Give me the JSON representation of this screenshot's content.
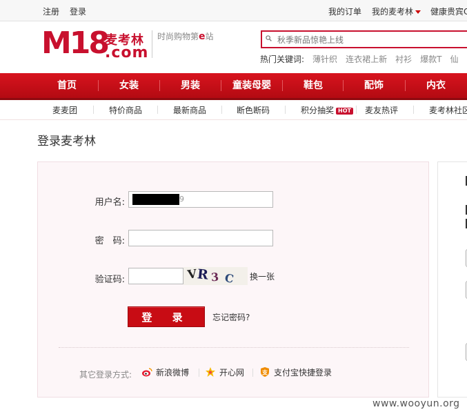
{
  "topbar": {
    "register": "注册",
    "login": "登录",
    "my_orders": "我的订单",
    "my_account": "我的麦考林",
    "partial_link": "健康贵宾C"
  },
  "header": {
    "logo_mark": "M18",
    "logo_cn": "麦考林",
    "logo_com": ".com",
    "slogan_pre": "时尚购物第",
    "slogan_e": "e",
    "slogan_post": "站",
    "search_placeholder": "秋季新品惊艳上线",
    "hot_label": "热门关键词:",
    "hot_words": [
      "薄针织",
      "连衣裙上新",
      "衬衫",
      "爆款T",
      "仙"
    ]
  },
  "main_nav": [
    "首页",
    "女装",
    "男装",
    "童装母婴",
    "鞋包",
    "配饰",
    "内衣"
  ],
  "sub_nav": {
    "items": [
      "麦麦团",
      "特价商品",
      "最新商品",
      "断色断码",
      "积分抽奖",
      "麦友热评",
      "麦考林社区"
    ],
    "hot_badge": "HOT"
  },
  "page_title": "登录麦考林",
  "form": {
    "username_label": "用户名:",
    "username_tail": "9",
    "password_label": "密　码:",
    "captcha_label": "验证码:",
    "captcha_text": [
      "V",
      "R",
      "3",
      "C"
    ],
    "refresh_label": "换一张",
    "login_button": "登 录",
    "forgot_label": "忘记密码?"
  },
  "other_login": {
    "label": "其它登录方式:",
    "options": [
      "新浪微博",
      "开心网",
      "支付宝快捷登录"
    ]
  },
  "watermark": "www.wooyun.org",
  "colors": {
    "brand_red": "#c8102e",
    "nav_red": "#c00d17"
  }
}
